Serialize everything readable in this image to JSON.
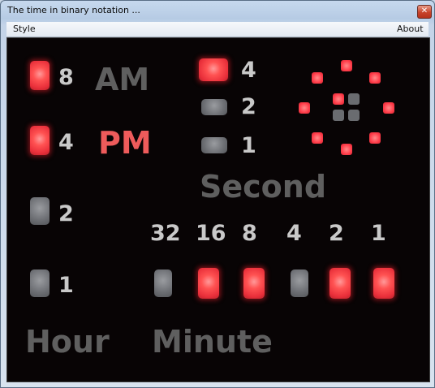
{
  "window": {
    "title": "The time in binary notation ...",
    "close_glyph": "✕"
  },
  "menu": {
    "style": "Style",
    "about": "About"
  },
  "hour": {
    "label": "Hour",
    "bits": [
      {
        "value": "8",
        "on": true
      },
      {
        "value": "4",
        "on": true
      },
      {
        "value": "2",
        "on": false
      },
      {
        "value": "1",
        "on": false
      }
    ]
  },
  "ampm": {
    "am": "AM",
    "pm": "PM",
    "current": "PM"
  },
  "second": {
    "label": "Second",
    "bits": [
      {
        "value": "4",
        "on": true
      },
      {
        "value": "2",
        "on": false
      },
      {
        "value": "1",
        "on": false
      }
    ]
  },
  "minute": {
    "label": "Minute",
    "bits": [
      {
        "value": "32",
        "on": false
      },
      {
        "value": "16",
        "on": true
      },
      {
        "value": "8",
        "on": true
      },
      {
        "value": "4",
        "on": false
      },
      {
        "value": "2",
        "on": true
      },
      {
        "value": "1",
        "on": true
      }
    ]
  },
  "colors": {
    "led_on": "#ff5252",
    "led_off": "#6e7075",
    "label_dim": "#5f5f5f",
    "pm_active": "#ee5b5b",
    "background": "#080405"
  }
}
